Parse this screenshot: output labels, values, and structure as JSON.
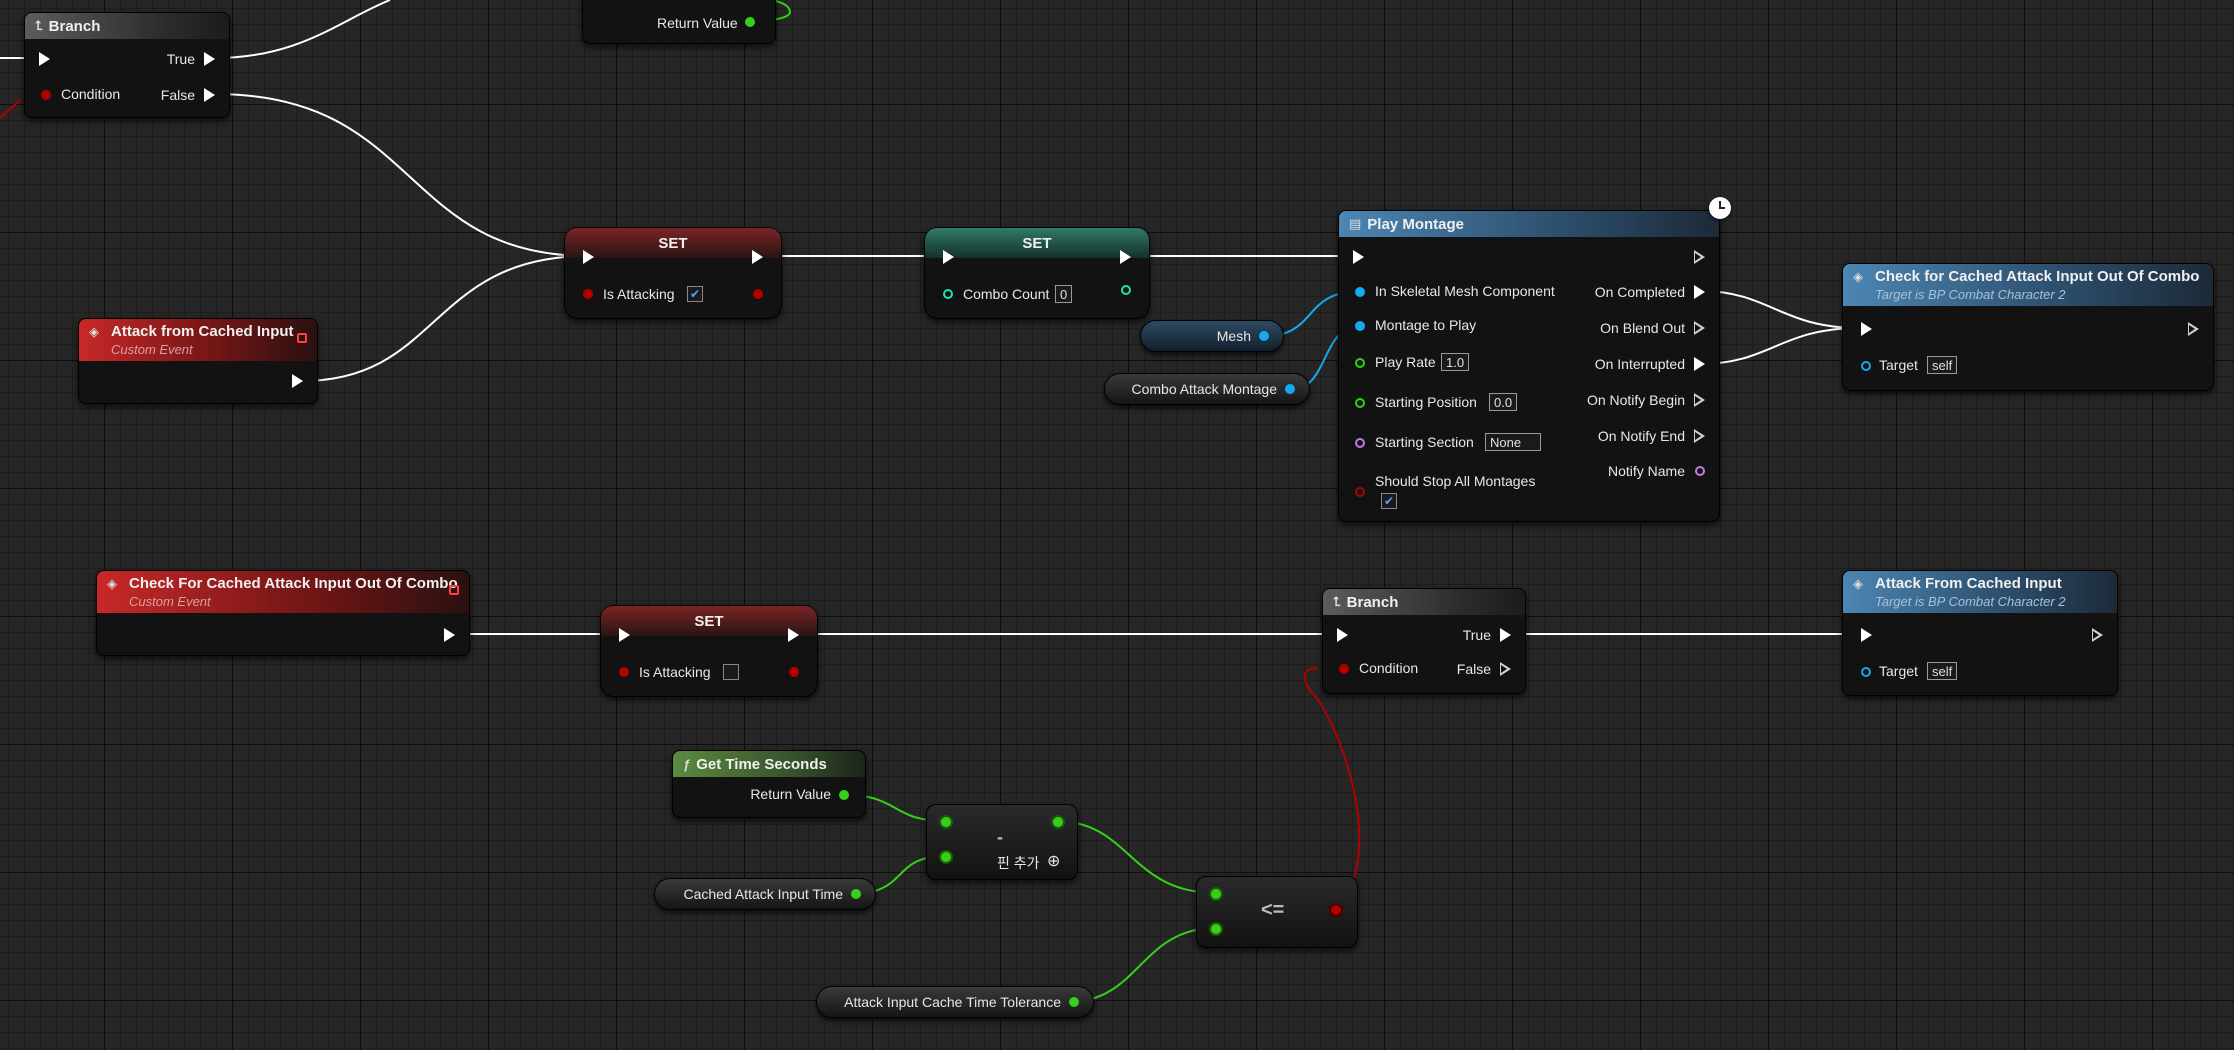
{
  "colors": {
    "exec": "#ffffff",
    "bool": "#b00000",
    "float": "#35d018",
    "object": "#17a9f0",
    "int": "#1fe3af",
    "name": "#c47ae8"
  },
  "icons": {
    "branch": "branch-icon",
    "event": "event-diamond-icon",
    "function": "function-icon",
    "montage": "montage-icon",
    "latent": "clock-icon"
  },
  "nodes": {
    "branch_top": {
      "title": "Branch",
      "true": "True",
      "false": "False",
      "condition": "Condition"
    },
    "return_top": {
      "return_value": "Return Value"
    },
    "set_attacking_top": {
      "title": "SET",
      "var": "Is Attacking",
      "checked": true
    },
    "set_combo": {
      "title": "SET",
      "var": "Combo Count",
      "value": "0"
    },
    "attack_event": {
      "title": "Attack from Cached Input",
      "subtitle": "Custom Event"
    },
    "play_montage": {
      "title": "Play Montage",
      "in_mesh": "In Skeletal Mesh Component",
      "montage": "Montage to Play",
      "play_rate": "Play Rate",
      "play_rate_val": "1.0",
      "start_pos": "Starting Position",
      "start_pos_val": "0.0",
      "start_sec": "Starting Section",
      "start_sec_val": "None",
      "stop_all": "Should Stop All Montages",
      "on_completed": "On Completed",
      "on_blend_out": "On Blend Out",
      "on_interrupted": "On Interrupted",
      "on_notify_begin": "On Notify Begin",
      "on_notify_end": "On Notify End",
      "notify_name": "Notify Name"
    },
    "mesh_var": {
      "label": "Mesh"
    },
    "combo_montage_var": {
      "label": "Combo Attack Montage"
    },
    "check_call_top": {
      "title": "Check for Cached Attack Input Out Of Combo",
      "subtitle": "Target is BP Combat Character 2",
      "target": "Target",
      "target_val": "self"
    },
    "check_event": {
      "title": "Check For Cached Attack Input Out Of Combo",
      "subtitle": "Custom Event"
    },
    "set_attacking_bottom": {
      "title": "SET",
      "var": "Is Attacking",
      "checked": false
    },
    "branch_bottom": {
      "title": "Branch",
      "true": "True",
      "false": "False",
      "condition": "Condition"
    },
    "attack_call": {
      "title": "Attack From Cached Input",
      "subtitle": "Target is BP Combat Character 2",
      "target": "Target",
      "target_val": "self"
    },
    "get_time": {
      "title": "Get Time Seconds",
      "return_value": "Return Value"
    },
    "subtract": {
      "op": "-",
      "add_pin": "핀 추가"
    },
    "cached_time_var": {
      "label": "Cached Attack Input Time"
    },
    "compare": {
      "op": "<="
    },
    "tolerance_var": {
      "label": "Attack Input Cache Time Tolerance"
    }
  }
}
